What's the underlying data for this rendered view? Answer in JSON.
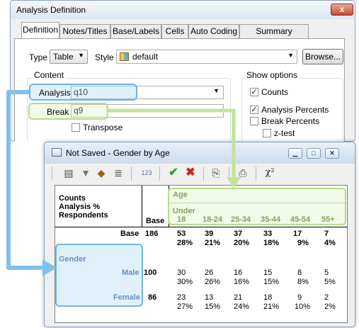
{
  "def_window": {
    "title": "Analysis Definition",
    "close_glyph": "x",
    "tabs": [
      {
        "label": "Definition"
      },
      {
        "label": "Notes/Titles"
      },
      {
        "label": "Base/Labels"
      },
      {
        "label": "Cells"
      },
      {
        "label": "Auto Coding"
      },
      {
        "label": "Summary Statistics"
      }
    ],
    "type_label": "Type",
    "type_value": "Table",
    "style_label": "Style",
    "style_value": "default",
    "browse_label": "Browse...",
    "content_label": "Content",
    "analysis_label": "Analysis",
    "analysis_value": "q10",
    "break_label": "Break",
    "break_value": "q9",
    "transpose_label": "Transpose",
    "show_options_label": "Show options",
    "options": [
      {
        "label": "Counts",
        "checked": true
      },
      {
        "label": "Analysis Percents",
        "checked": true
      },
      {
        "label": "Break Percents",
        "checked": false
      },
      {
        "label": "z-test",
        "checked": false
      }
    ]
  },
  "table_window": {
    "title": "Not Saved - Gender by Age",
    "toolbar_icons": [
      "properties-icon",
      "filter-icon",
      "paint-icon",
      "text-icon",
      "number-format-icon",
      "check-icon",
      "cancel-icon",
      "copy-icon",
      "print-icon",
      "chi-square-icon"
    ],
    "number_format_glyph": "123",
    "chi_glyph": "χ²",
    "table": {
      "corner_lines": [
        "Counts",
        "Analysis %",
        "Respondents"
      ],
      "base_header": "Base",
      "break_title": "Age",
      "columns": [
        {
          "line1": "Under",
          "line2": "18"
        },
        {
          "line1": "",
          "line2": "18-24"
        },
        {
          "line1": "",
          "line2": "25-34"
        },
        {
          "line1": "",
          "line2": "35-44"
        },
        {
          "line1": "",
          "line2": "45-54"
        },
        {
          "line1": "",
          "line2": "55+"
        }
      ],
      "base_row": {
        "label": "Base",
        "base": "186",
        "counts": [
          "53",
          "39",
          "37",
          "33",
          "17",
          "7"
        ],
        "pcts": [
          "28%",
          "21%",
          "20%",
          "18%",
          "9%",
          "4%"
        ]
      },
      "analysis_title": "Gender",
      "rows": [
        {
          "label": "Male",
          "base": "100",
          "counts": [
            "30",
            "26",
            "16",
            "15",
            "8",
            "5"
          ],
          "pcts": [
            "30%",
            "26%",
            "16%",
            "15%",
            "8%",
            "5%"
          ]
        },
        {
          "label": "Female",
          "base": "86",
          "counts": [
            "23",
            "13",
            "21",
            "18",
            "9",
            "2"
          ],
          "pcts": [
            "27%",
            "15%",
            "24%",
            "21%",
            "10%",
            "2%"
          ]
        }
      ]
    }
  },
  "colors": {
    "blue_highlight": "#6ab4e8",
    "green_highlight": "#b6dc8c",
    "header_green_text": "#5a7a2a"
  }
}
